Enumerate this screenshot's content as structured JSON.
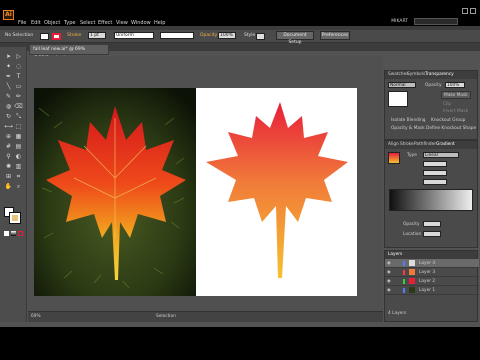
{
  "app": {
    "logo": "Ai",
    "workspace": "MIKART"
  },
  "menu": [
    "File",
    "Edit",
    "Object",
    "Type",
    "Select",
    "Effect",
    "View",
    "Window",
    "Help"
  ],
  "control_bar": {
    "selection": "No Selection",
    "stroke_label": "Stroke",
    "stroke_value": "1 pt",
    "profile": "Uniform",
    "opacity_label": "Opacity",
    "opacity_value": "100%",
    "style_label": "Style",
    "doc_setup": "Document Setup",
    "preferences": "Preferences"
  },
  "document_tab": {
    "title": "fall leaf new.ai* @ 69% (RGB/Preview)"
  },
  "status": {
    "zoom": "69%",
    "tool": "Selection"
  },
  "transparency_panel": {
    "tabs": [
      "Swatches",
      "Symbols",
      "Transparency"
    ],
    "blend_mode": "Normal",
    "opacity_label": "Opacity",
    "opacity_value": "100%",
    "make_mask": "Make Mask",
    "clip": "Clip",
    "invert": "Invert Mask",
    "isolate": "Isolate Blending",
    "knockout": "Knockout Group",
    "opacity_mask_opt": "Opacity & Mask Define Knockout Shape"
  },
  "gradient_panel": {
    "tabs": [
      "Align",
      "Stroke",
      "Pathfinder",
      "Gradient"
    ],
    "type_label": "Type",
    "type_value": "Linear",
    "location_label": "Location",
    "opacity_label": "Opacity"
  },
  "layers_panel": {
    "title": "Layers",
    "footer": "4 Layers",
    "layers": [
      {
        "name": "Layer 4",
        "color": "#4f7cff"
      },
      {
        "name": "Layer 3",
        "color": "#ff3a3a"
      },
      {
        "name": "Layer 2",
        "color": "#3ad13a"
      },
      {
        "name": "Layer 1",
        "color": "#4f7cff"
      }
    ]
  },
  "colors": {
    "accent": "#e87f1c",
    "leaf_top": "#e81d3a",
    "leaf_bottom": "#f7c02e"
  }
}
